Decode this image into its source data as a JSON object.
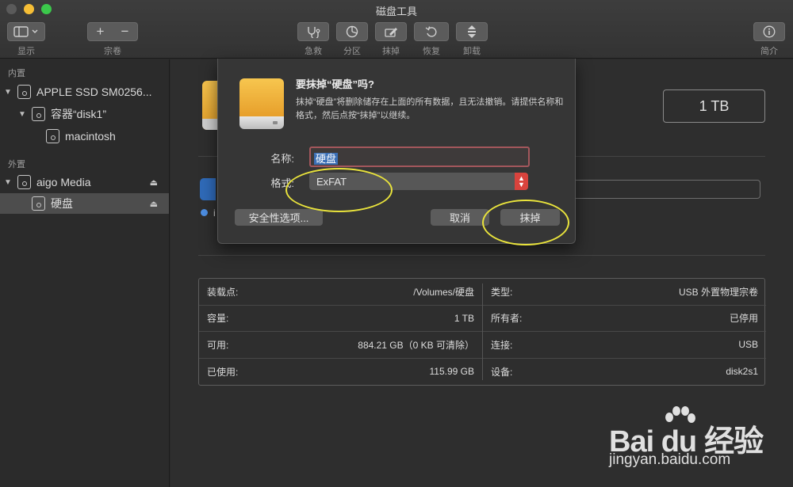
{
  "window": {
    "title": "磁盘工具"
  },
  "toolbar": {
    "left": {
      "view_label": "显示",
      "volume_label": "宗卷",
      "plus": "+",
      "minus": "−"
    },
    "items": [
      {
        "label": "急救"
      },
      {
        "label": "分区"
      },
      {
        "label": "抹掉"
      },
      {
        "label": "恢复"
      },
      {
        "label": "卸载"
      }
    ],
    "info_label": "简介"
  },
  "sidebar": {
    "internal_header": "内置",
    "external_header": "外置",
    "items": [
      {
        "label": "APPLE SSD SM0256..."
      },
      {
        "label": "容器“disk1”"
      },
      {
        "label": "macintosh"
      },
      {
        "label": "aigo Media"
      },
      {
        "label": "硬盘"
      }
    ]
  },
  "main": {
    "capacity": "1 TB",
    "ghost_text": "i",
    "info": {
      "left": [
        {
          "key": "装载点:",
          "value": "/Volumes/硬盘"
        },
        {
          "key": "容量:",
          "value": "1 TB"
        },
        {
          "key": "可用:",
          "value": "884.21 GB（0 KB 可清除）"
        },
        {
          "key": "已使用:",
          "value": "115.99 GB"
        }
      ],
      "right": [
        {
          "key": "类型:",
          "value": "USB 外置物理宗卷"
        },
        {
          "key": "所有者:",
          "value": "已停用"
        },
        {
          "key": "连接:",
          "value": "USB"
        },
        {
          "key": "设备:",
          "value": "disk2s1"
        }
      ]
    }
  },
  "dialog": {
    "title": "要抹掉“硬盘”吗?",
    "message": "抹掉“硬盘”将删除储存在上面的所有数据，且无法撤销。请提供名称和格式，然后点按“抹掉”以继续。",
    "name_label": "名称:",
    "name_value": "硬盘",
    "format_label": "格式:",
    "format_value": "ExFAT",
    "security_button": "安全性选项...",
    "cancel_button": "取消",
    "erase_button": "抹掉"
  },
  "watermark": {
    "brand": "Bai  du",
    "brand_cn": "经验",
    "url": "jingyan.baidu.com"
  },
  "colors": {
    "highlight": "#e9e33c",
    "accent_blue": "#3b6fb6",
    "select_red": "#d9433d",
    "disk_orange": "#f0b23d"
  }
}
